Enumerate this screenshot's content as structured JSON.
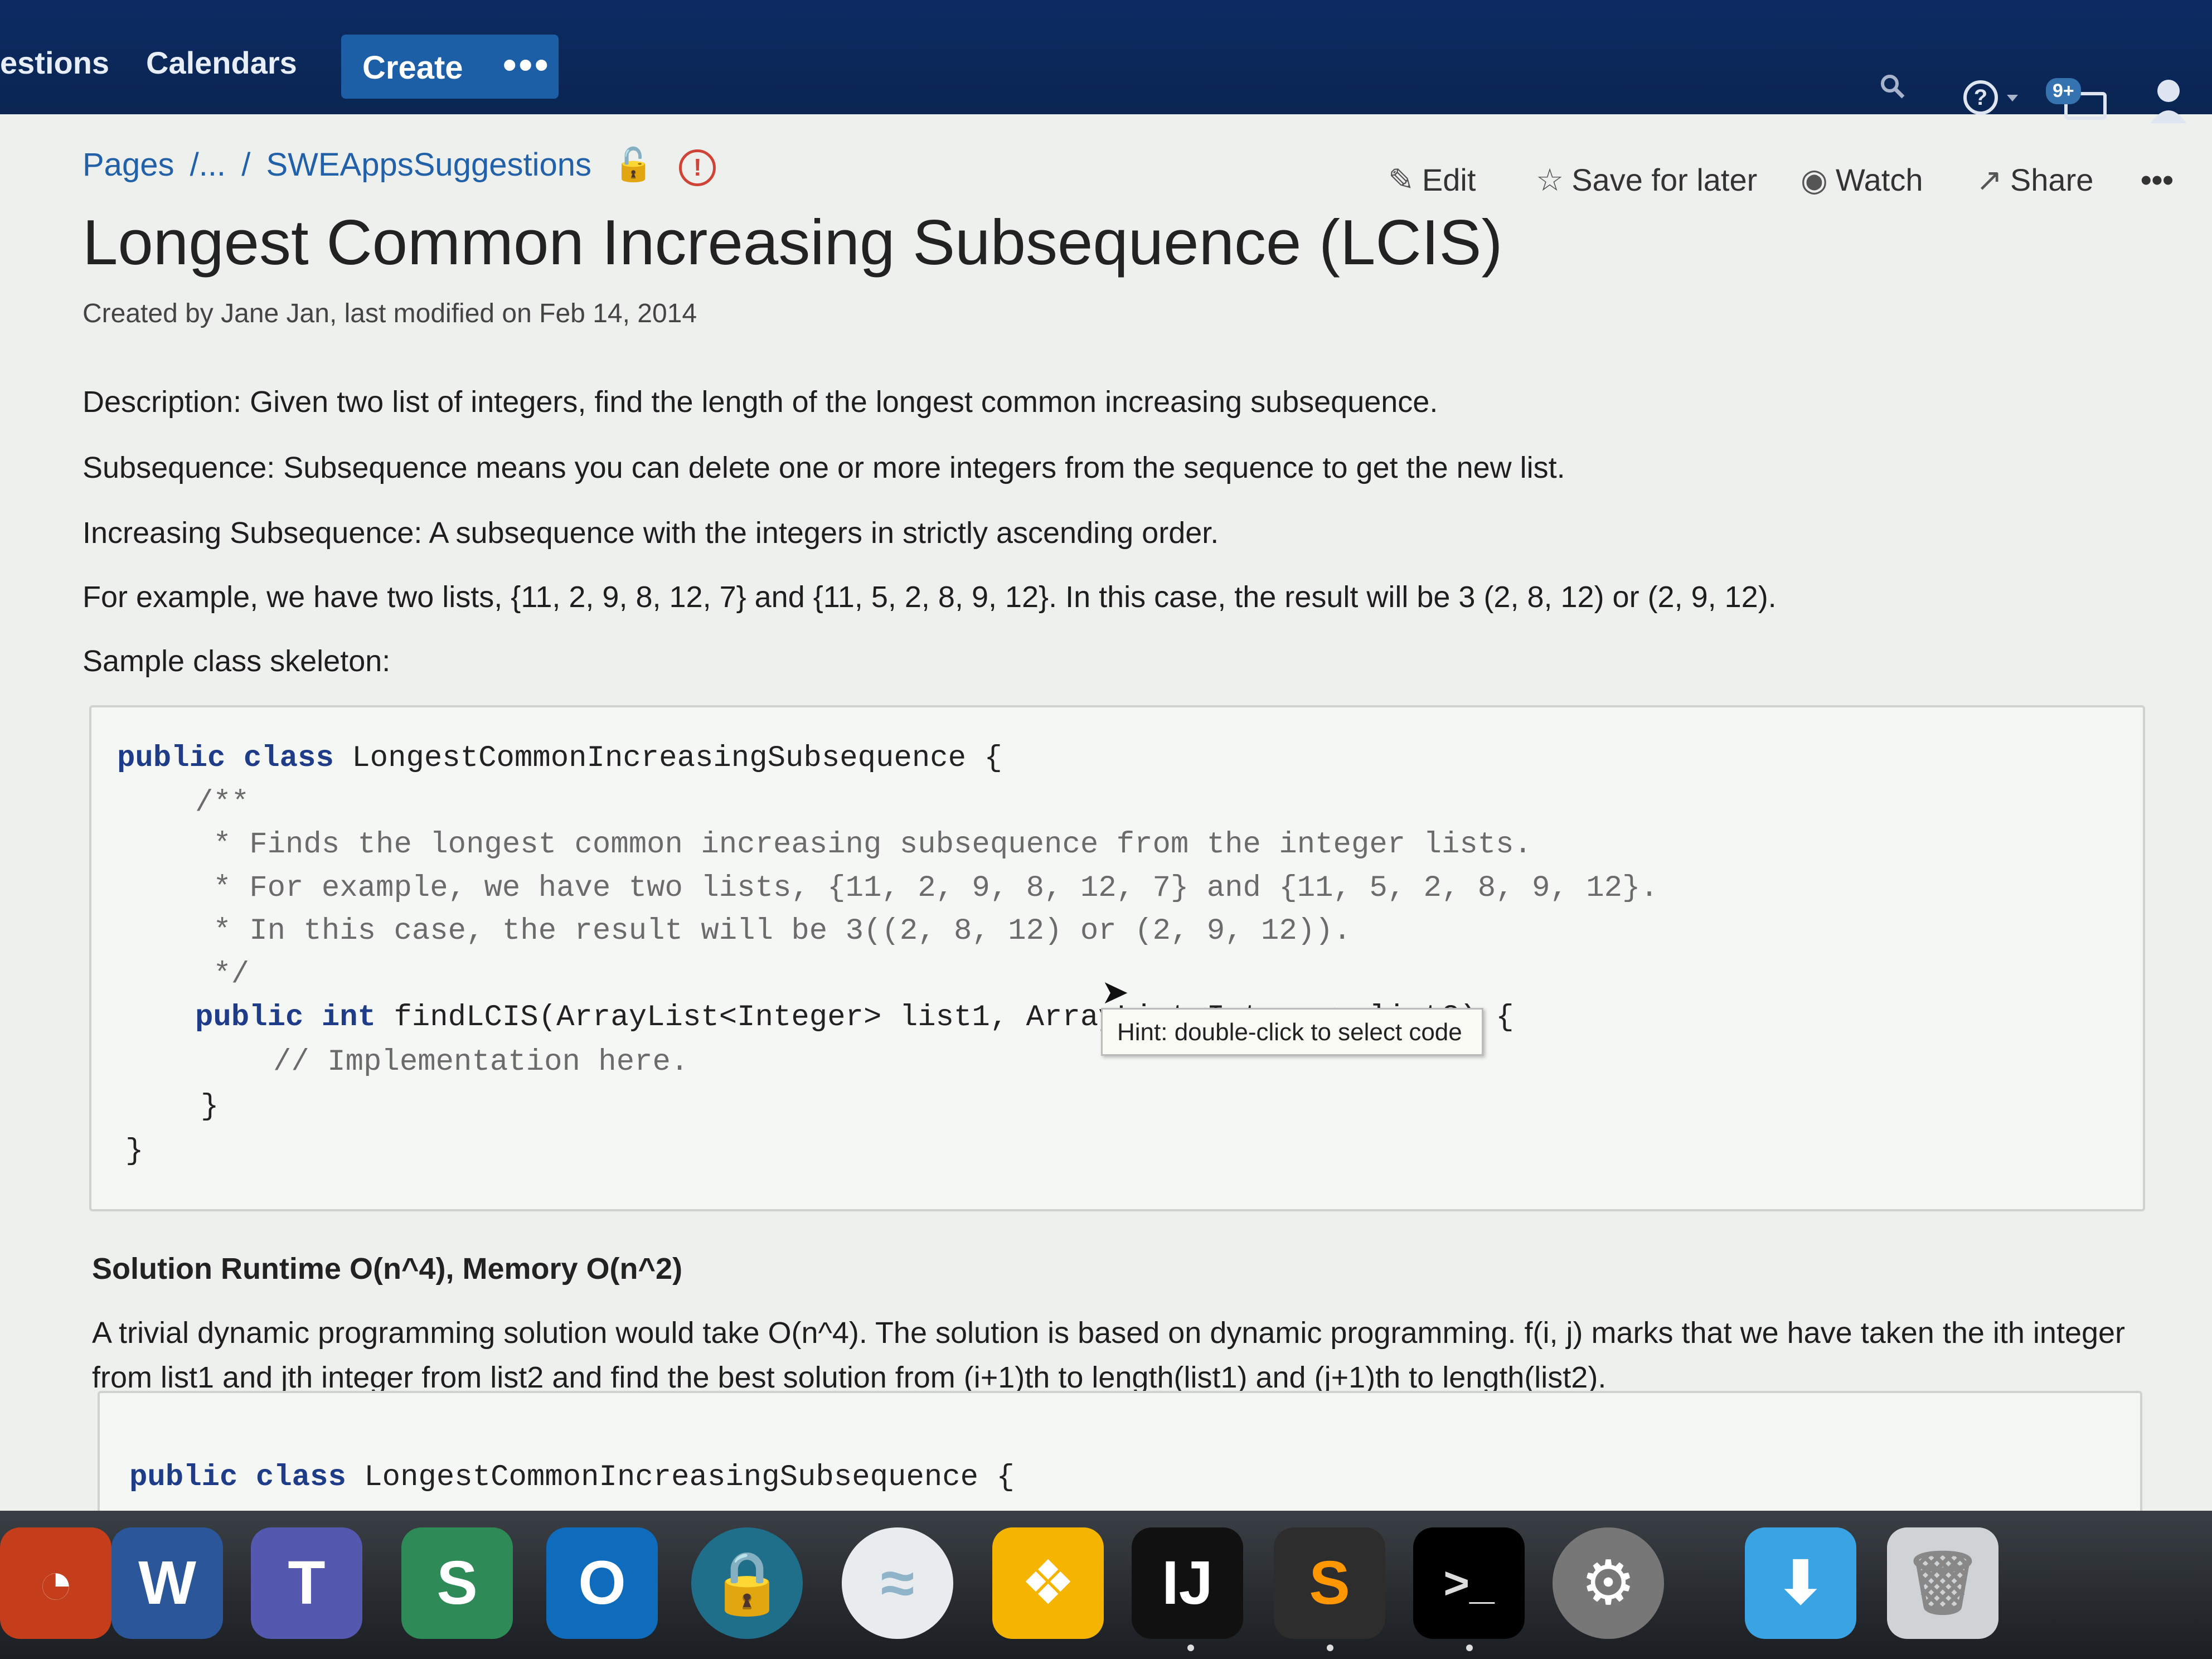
{
  "nav": {
    "items": [
      "estions",
      "Calendars"
    ],
    "create_label": "Create",
    "more_label": "•••",
    "badge": "9+"
  },
  "breadcrumb": [
    "Pages",
    "/...",
    "/",
    "SWEAppsSuggestions"
  ],
  "actions": {
    "edit": "Edit",
    "save": "Save for later",
    "watch": "Watch",
    "share": "Share",
    "more": "•••"
  },
  "page": {
    "title": "Longest Common Increasing Subsequence (LCIS)",
    "meta": "Created by Jane Jan, last modified on Feb 14, 2014",
    "paragraphs": [
      "Description: Given two list of integers, find the length of the longest common increasing subsequence.",
      "Subsequence: Subsequence means you can delete one or more integers from the sequence to get the new list.",
      "Increasing Subsequence: A subsequence with the integers in strictly ascending order.",
      "For example, we have two lists, {11, 2, 9, 8, 12, 7} and {11, 5, 2, 8, 9, 12}. In this case, the result will be 3 (2, 8, 12) or (2, 9, 12).",
      "Sample class skeleton:"
    ]
  },
  "code": {
    "line1_kw": "public class",
    "line1_rest": " LongestCommonIncreasingSubsequence {",
    "line2": "/**",
    "line3": " * Finds the longest common increasing subsequence from the integer lists.",
    "line4": " * For example, we have two lists, {11, 2, 9, 8, 12, 7} and {11, 5, 2, 8, 9, 12}.",
    "line5": " * In this case, the result will be 3((2, 8, 12) or (2, 9, 12)).",
    "line6": " */",
    "line7_kw": "public int",
    "line7_rest": " findLCIS(ArrayList<Integer> list1, ArrayList<Integer> list2) {",
    "line8": "// Implementation here.",
    "line9": "}",
    "line10": "}"
  },
  "tooltip": "Hint: double-click to select code",
  "solution": {
    "heading": "Solution Runtime O(n^4), Memory O(n^2)",
    "text1": "A trivial dynamic programming solution would take O(n^4). The solution is based on dynamic programming. f(i, j) marks that we have taken the ith integer",
    "text2": "from list1 and jth integer from list2 and find the best solution from (i+1)th to length(list1) and (j+1)th to length(list2).",
    "code_kw": "public class",
    "code_rest": " LongestCommonIncreasingSubsequence {"
  },
  "dock": {
    "apps": [
      "W",
      "T",
      "S",
      "O",
      "",
      "",
      "",
      "IJ",
      "",
      ">_",
      "",
      "",
      ""
    ]
  }
}
